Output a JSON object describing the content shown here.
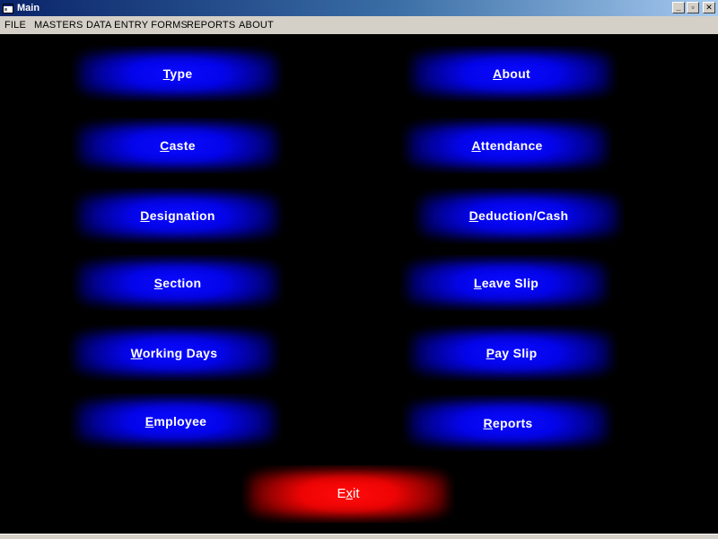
{
  "window": {
    "title": "Main",
    "minimize_glyph": "_",
    "maximize_glyph": "▫",
    "close_glyph": "✕"
  },
  "menu": {
    "items": [
      {
        "label": "FILE"
      },
      {
        "label": "MASTERS"
      },
      {
        "label": "DATA ENTRY FORMS"
      },
      {
        "label": "REPORTS"
      },
      {
        "label": "ABOUT"
      }
    ]
  },
  "buttons": {
    "left": [
      {
        "first": "T",
        "rest": "ype"
      },
      {
        "first": "C",
        "rest": "aste"
      },
      {
        "first": "D",
        "rest": "esignation"
      },
      {
        "first": "S",
        "rest": "ection"
      },
      {
        "first": "W",
        "rest": "orking Days"
      },
      {
        "first": "E",
        "rest": "mployee"
      }
    ],
    "right": [
      {
        "first": "A",
        "rest": "bout"
      },
      {
        "first": "A",
        "rest": "ttendance"
      },
      {
        "first": "D",
        "rest": "eduction/Cash"
      },
      {
        "first": "L",
        "rest": "eave Slip"
      },
      {
        "first": "P",
        "rest": "ay Slip"
      },
      {
        "first": "R",
        "rest": "eports"
      }
    ],
    "exit": {
      "pre": "E",
      "mnemonic": "x",
      "post": "it"
    }
  },
  "colors": {
    "button_blue": "#0404ea",
    "button_red": "#ee0404",
    "background": "#000000",
    "menubar": "#d4d0c8"
  }
}
